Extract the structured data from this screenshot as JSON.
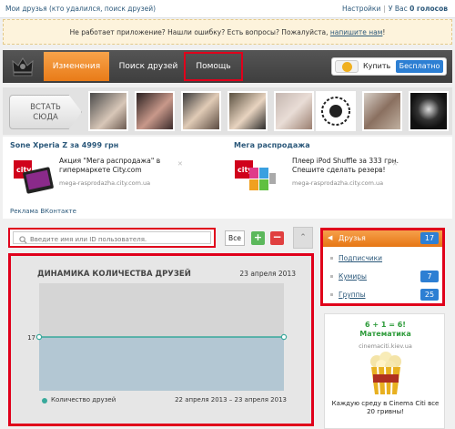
{
  "topbar": {
    "title": "Мои друзья (кто удалился, поиск друзей)",
    "settings": "Настройки",
    "separator": "|",
    "balance_prefix": "У Вас",
    "balance_value": "0 голосов"
  },
  "notice": {
    "text": "Не работает приложение? Нашли ошибку? Есть вопросы? Пожалуйста, ",
    "link": "напишите нам",
    "suffix": "!"
  },
  "navbar": {
    "tabs": [
      "Изменения",
      "Поиск друзей",
      "Помощь"
    ],
    "coin_box": {
      "buy": "Купить",
      "free": "Бесплатно"
    }
  },
  "strip": {
    "join_label_1": "ВСТАТЬ",
    "join_label_2": "СЮДА"
  },
  "ads": [
    {
      "title": "Sone Xperia Z за 4999 грн",
      "text": "Акция \"Мега распродажа\" в гипермаркете City.com",
      "url": "mega-rasprodazha.city.com.ua"
    },
    {
      "title": "Мега распродажа",
      "text": "Плеер iPod Shuffle за 333 грн. Спешите сделать резерв!",
      "url": "mega-rasprodazha.city.com.ua"
    }
  ],
  "ads_footer": "Реклама ВКонтакте",
  "ad_close": "✕",
  "search": {
    "placeholder": "Введите имя или ID пользователя."
  },
  "controls": {
    "all": "Все",
    "plus": "+",
    "minus": "−",
    "collapse": "⌃"
  },
  "chart_data": {
    "type": "line",
    "title": "ДИНАМИКА КОЛИЧЕСТВА ДРУЗЕЙ",
    "date": "23 апреля 2013",
    "series": [
      {
        "name": "Количество друзей",
        "values": [
          17,
          17
        ]
      }
    ],
    "x": [
      "22 апреля 2013",
      "23 апреля 2013"
    ],
    "y_tick": "17",
    "range_label": "22 апреля 2013 – 23 апреля 2013",
    "color": "#38a99b",
    "fill": "#b3c7d3"
  },
  "menu": {
    "active": {
      "label": "Друзья",
      "count": "17"
    },
    "items": [
      {
        "label": "Подписчики",
        "count": ""
      },
      {
        "label": "Кумиры",
        "count": "7"
      },
      {
        "label": "Группы",
        "count": "25"
      }
    ]
  },
  "promo": {
    "title_line1": "6 + 1 = 6!",
    "title_line2": "Математика",
    "url": "cinemaciti.kiev.ua",
    "text": "Каждую среду в Cinema Citi все 20 гривны!"
  }
}
